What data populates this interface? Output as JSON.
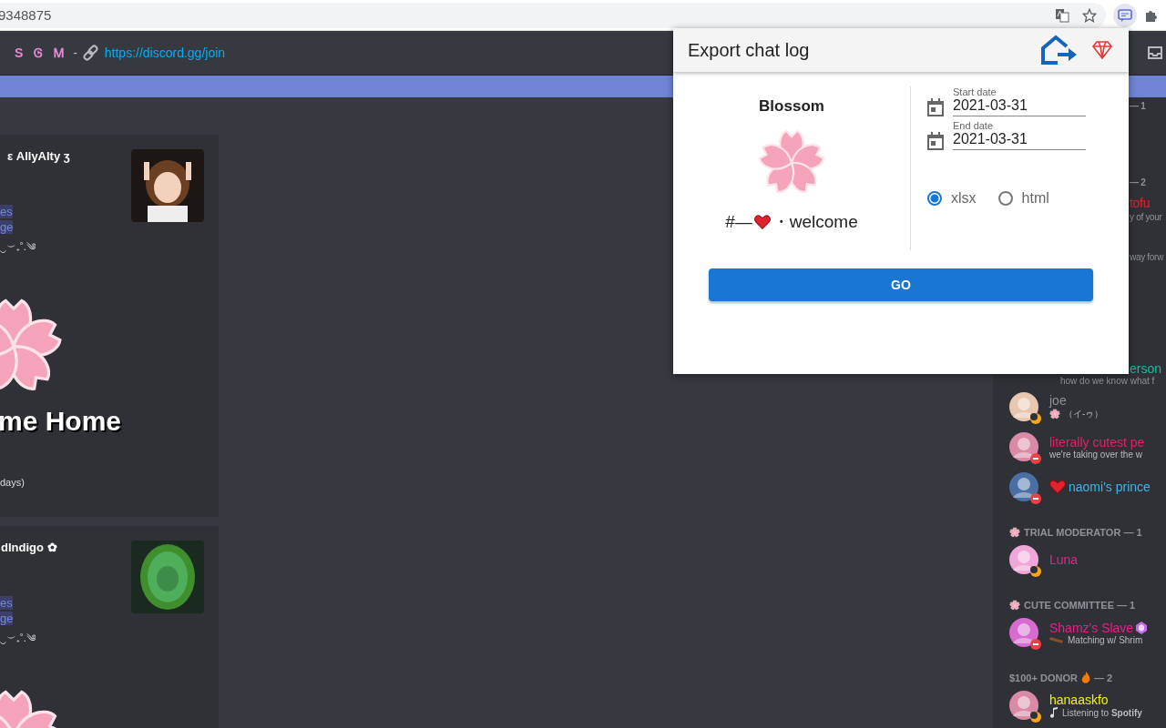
{
  "address_bar": {
    "url": "9348875"
  },
  "channel_header": {
    "glyphs": "S Ꮆ Ꮇ",
    "separator": "-",
    "link": "https://discord.gg/join"
  },
  "embeds": [
    {
      "author": "ε AllyAlty ʒ",
      "links": [
        "es",
        "ge"
      ],
      "decoration": "‿︶₊˚.༄",
      "title": "me Home",
      "footer": "days)"
    },
    {
      "author": "dIndigo ✿",
      "links": [
        "es",
        "ge"
      ],
      "decoration": "‿︶₊˚.༄"
    }
  ],
  "member_list": [
    {
      "kind": "header-fragment",
      "label": "— 1"
    },
    {
      "kind": "header-fragment",
      "label": "— 2"
    },
    {
      "kind": "name-fragment",
      "label": "tofu",
      "color": "#d9262c"
    },
    {
      "kind": "status-fragment",
      "label": "y of your"
    },
    {
      "kind": "status-fragment",
      "label": "way forw"
    },
    {
      "kind": "member-fragment",
      "name": "erson",
      "color": "#1abc9c",
      "status": "how do we know what f"
    },
    {
      "kind": "member",
      "name": "joe",
      "color": "#8e9297",
      "status": "（イ-ゥ）",
      "dnd": false
    },
    {
      "kind": "member",
      "name": "literally cutest pe",
      "color": "#e91e63",
      "status": "we're taking over the w",
      "dnd": true
    },
    {
      "kind": "member",
      "name": "naomi's prince",
      "color": "#3fb6e8",
      "dnd": true
    },
    {
      "kind": "header",
      "label": "TRIAL MODERATOR — 1"
    },
    {
      "kind": "member",
      "name": "Luna",
      "color": "#e91e8c",
      "dnd": false
    },
    {
      "kind": "header",
      "label": "CUTE COMMITTEE — 1"
    },
    {
      "kind": "member",
      "name": "Shamz's Slave",
      "color": "#e91e8c",
      "status": "Matching w/ Shrim",
      "dnd": true
    },
    {
      "kind": "header",
      "label": "$100+ DONOR",
      "count": "— 2"
    },
    {
      "kind": "member",
      "name": "hanaaskfo",
      "color": "#f1f10f",
      "status": "Listening to **Spotify**",
      "dnd": false
    }
  ],
  "popup": {
    "title": "Export chat log",
    "server": "Blossom",
    "channel_prefix": "#—",
    "channel_name": "・welcome",
    "start_label": "Start date",
    "start_value": "2021-03-31",
    "end_label": "End date",
    "end_value": "2021-03-31",
    "formats": [
      {
        "label": "xlsx",
        "selected": true
      },
      {
        "label": "html",
        "selected": false
      }
    ],
    "button": "GO"
  }
}
